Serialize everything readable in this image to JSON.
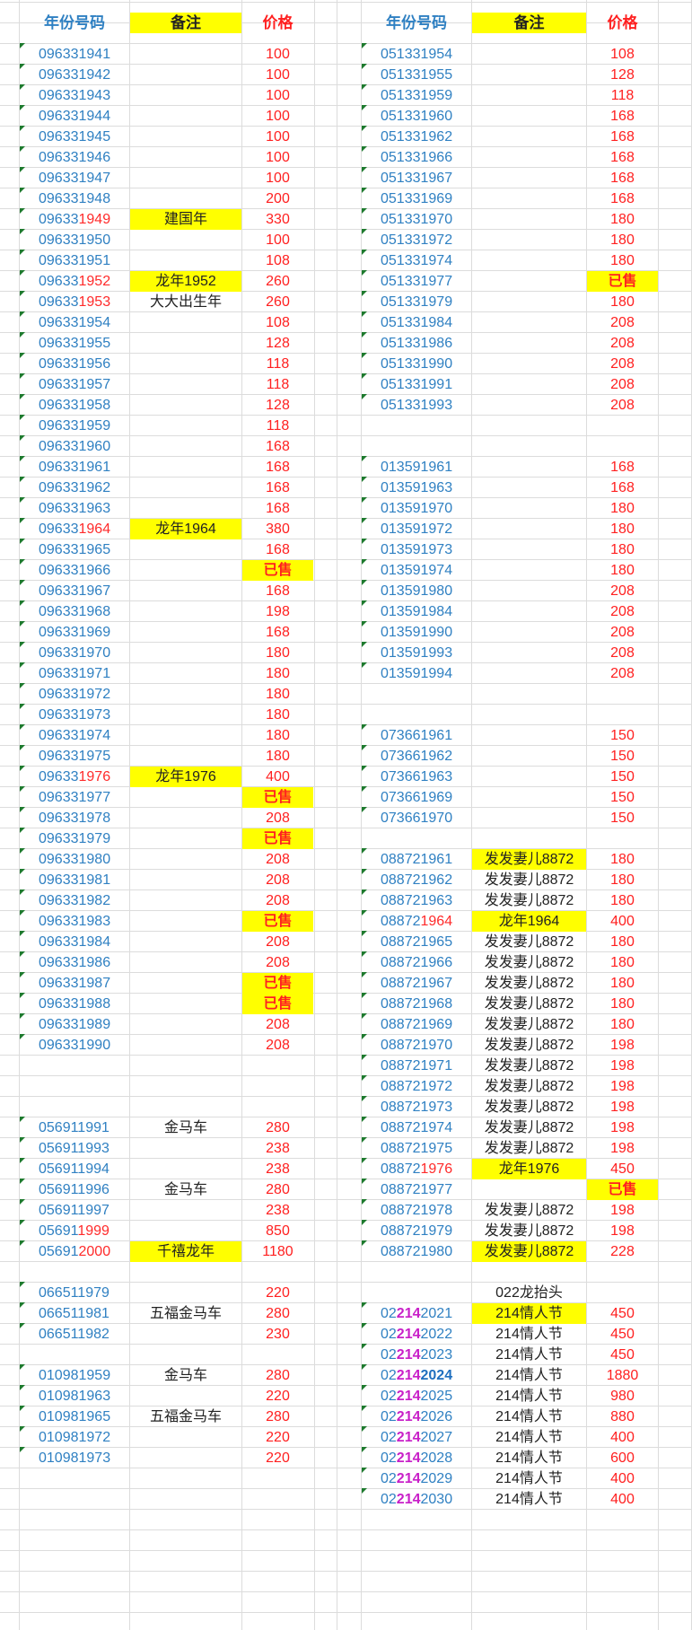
{
  "headers": {
    "left": {
      "number": "年份号码",
      "note": "备注",
      "price": "价格"
    },
    "right": {
      "number": "年份号码",
      "note": "备注",
      "price": "价格"
    }
  },
  "colors": {
    "number_blue": "#2f80c2",
    "red": "#ff2a2a",
    "yellow": "#ffff00",
    "purple": "#c81fc8",
    "green_marker": "#1e7a2e"
  },
  "left_rows": [
    {
      "row": 3,
      "parts": [
        "096331941"
      ],
      "note": "",
      "price": "100"
    },
    {
      "row": 4,
      "parts": [
        "096331942"
      ],
      "note": "",
      "price": "100"
    },
    {
      "row": 5,
      "parts": [
        "096331943"
      ],
      "note": "",
      "price": "100"
    },
    {
      "row": 6,
      "parts": [
        "096331944"
      ],
      "note": "",
      "price": "100"
    },
    {
      "row": 7,
      "parts": [
        "096331945"
      ],
      "note": "",
      "price": "100"
    },
    {
      "row": 8,
      "parts": [
        "096331946"
      ],
      "note": "",
      "price": "100"
    },
    {
      "row": 9,
      "parts": [
        "096331947"
      ],
      "note": "",
      "price": "100"
    },
    {
      "row": 10,
      "parts": [
        "096331948"
      ],
      "note": "",
      "price": "200"
    },
    {
      "row": 11,
      "parts": [
        "09633",
        "1949"
      ],
      "note": "建国年",
      "note_hl": true,
      "price": "330"
    },
    {
      "row": 12,
      "parts": [
        "096331950"
      ],
      "note": "",
      "price": "100"
    },
    {
      "row": 13,
      "parts": [
        "096331951"
      ],
      "note": "",
      "price": "108"
    },
    {
      "row": 14,
      "parts": [
        "09633",
        "1952"
      ],
      "note": "龙年1952",
      "note_hl": true,
      "price": "260"
    },
    {
      "row": 15,
      "parts": [
        "09633",
        "1953"
      ],
      "note": "大大出生年",
      "price": "260"
    },
    {
      "row": 16,
      "parts": [
        "096331954"
      ],
      "note": "",
      "price": "108"
    },
    {
      "row": 17,
      "parts": [
        "096331955"
      ],
      "note": "",
      "price": "128"
    },
    {
      "row": 18,
      "parts": [
        "096331956"
      ],
      "note": "",
      "price": "118"
    },
    {
      "row": 19,
      "parts": [
        "096331957"
      ],
      "note": "",
      "price": "118"
    },
    {
      "row": 20,
      "parts": [
        "096331958"
      ],
      "note": "",
      "price": "128"
    },
    {
      "row": 21,
      "parts": [
        "096331959"
      ],
      "note": "",
      "price": "118"
    },
    {
      "row": 22,
      "parts": [
        "096331960"
      ],
      "note": "",
      "price": "168"
    },
    {
      "row": 23,
      "parts": [
        "096331961"
      ],
      "note": "",
      "price": "168"
    },
    {
      "row": 24,
      "parts": [
        "096331962"
      ],
      "note": "",
      "price": "168"
    },
    {
      "row": 25,
      "parts": [
        "096331963"
      ],
      "note": "",
      "price": "168"
    },
    {
      "row": 26,
      "parts": [
        "09633",
        "1964"
      ],
      "note": "龙年1964",
      "note_hl": true,
      "price": "380"
    },
    {
      "row": 27,
      "parts": [
        "096331965"
      ],
      "note": "",
      "price": "168"
    },
    {
      "row": 28,
      "parts": [
        "096331966"
      ],
      "note": "",
      "price": "已售",
      "sold": true
    },
    {
      "row": 29,
      "parts": [
        "096331967"
      ],
      "note": "",
      "price": "168"
    },
    {
      "row": 30,
      "parts": [
        "096331968"
      ],
      "note": "",
      "price": "198"
    },
    {
      "row": 31,
      "parts": [
        "096331969"
      ],
      "note": "",
      "price": "168"
    },
    {
      "row": 32,
      "parts": [
        "096331970"
      ],
      "note": "",
      "price": "180"
    },
    {
      "row": 33,
      "parts": [
        "096331971"
      ],
      "note": "",
      "price": "180"
    },
    {
      "row": 34,
      "parts": [
        "096331972"
      ],
      "note": "",
      "price": "180"
    },
    {
      "row": 35,
      "parts": [
        "096331973"
      ],
      "note": "",
      "price": "180"
    },
    {
      "row": 36,
      "parts": [
        "096331974"
      ],
      "note": "",
      "price": "180"
    },
    {
      "row": 37,
      "parts": [
        "096331975"
      ],
      "note": "",
      "price": "180"
    },
    {
      "row": 38,
      "parts": [
        "09633",
        "1976"
      ],
      "note": "龙年1976",
      "note_hl": true,
      "price": "400"
    },
    {
      "row": 39,
      "parts": [
        "096331977"
      ],
      "note": "",
      "price": "已售",
      "sold": true
    },
    {
      "row": 40,
      "parts": [
        "096331978"
      ],
      "note": "",
      "price": "208"
    },
    {
      "row": 41,
      "parts": [
        "096331979"
      ],
      "note": "",
      "price": "已售",
      "sold": true
    },
    {
      "row": 42,
      "parts": [
        "096331980"
      ],
      "note": "",
      "price": "208"
    },
    {
      "row": 43,
      "parts": [
        "096331981"
      ],
      "note": "",
      "price": "208"
    },
    {
      "row": 44,
      "parts": [
        "096331982"
      ],
      "note": "",
      "price": "208"
    },
    {
      "row": 45,
      "parts": [
        "096331983"
      ],
      "note": "",
      "price": "已售",
      "sold": true
    },
    {
      "row": 46,
      "parts": [
        "096331984"
      ],
      "note": "",
      "price": "208"
    },
    {
      "row": 47,
      "parts": [
        "096331986"
      ],
      "note": "",
      "price": "208"
    },
    {
      "row": 48,
      "parts": [
        "096331987"
      ],
      "note": "",
      "price": "已售",
      "sold": true
    },
    {
      "row": 49,
      "parts": [
        "096331988"
      ],
      "note": "",
      "price": "已售",
      "sold": true
    },
    {
      "row": 50,
      "parts": [
        "096331989"
      ],
      "note": "",
      "price": "208"
    },
    {
      "row": 51,
      "parts": [
        "096331990"
      ],
      "note": "",
      "price": "208"
    },
    {
      "row": 55,
      "parts": [
        "056911991"
      ],
      "note": "金马车",
      "price": "280"
    },
    {
      "row": 56,
      "parts": [
        "056911993"
      ],
      "note": "",
      "price": "238"
    },
    {
      "row": 57,
      "parts": [
        "056911994"
      ],
      "note": "",
      "price": "238"
    },
    {
      "row": 58,
      "parts": [
        "056911996"
      ],
      "note": "金马车",
      "price": "280"
    },
    {
      "row": 59,
      "parts": [
        "056911997"
      ],
      "note": "",
      "price": "238"
    },
    {
      "row": 60,
      "parts": [
        "05691",
        "1999"
      ],
      "note": "",
      "price": "850"
    },
    {
      "row": 61,
      "parts": [
        "05691",
        "2000"
      ],
      "note": "千禧龙年",
      "note_hl": true,
      "price": "1180"
    },
    {
      "row": 63,
      "parts": [
        "066511979"
      ],
      "note": "",
      "price": "220"
    },
    {
      "row": 64,
      "parts": [
        "066511981"
      ],
      "note": "五福金马车",
      "price": "280"
    },
    {
      "row": 65,
      "parts": [
        "066511982"
      ],
      "note": "",
      "price": "230"
    },
    {
      "row": 67,
      "parts": [
        "010981959"
      ],
      "note": "金马车",
      "price": "280"
    },
    {
      "row": 68,
      "parts": [
        "010981963"
      ],
      "note": "",
      "price": "220"
    },
    {
      "row": 69,
      "parts": [
        "010981965"
      ],
      "note": "五福金马车",
      "price": "280"
    },
    {
      "row": 70,
      "parts": [
        "010981972"
      ],
      "note": "",
      "price": "220"
    },
    {
      "row": 71,
      "parts": [
        "010981973"
      ],
      "note": "",
      "price": "220"
    }
  ],
  "right_rows": [
    {
      "row": 3,
      "parts": [
        "051331954"
      ],
      "note": "",
      "price": "108"
    },
    {
      "row": 4,
      "parts": [
        "051331955"
      ],
      "note": "",
      "price": "128"
    },
    {
      "row": 5,
      "parts": [
        "051331959"
      ],
      "note": "",
      "price": "118"
    },
    {
      "row": 6,
      "parts": [
        "051331960"
      ],
      "note": "",
      "price": "168"
    },
    {
      "row": 7,
      "parts": [
        "051331962"
      ],
      "note": "",
      "price": "168"
    },
    {
      "row": 8,
      "parts": [
        "051331966"
      ],
      "note": "",
      "price": "168"
    },
    {
      "row": 9,
      "parts": [
        "051331967"
      ],
      "note": "",
      "price": "168"
    },
    {
      "row": 10,
      "parts": [
        "051331969"
      ],
      "note": "",
      "price": "168"
    },
    {
      "row": 11,
      "parts": [
        "051331970"
      ],
      "note": "",
      "price": "180"
    },
    {
      "row": 12,
      "parts": [
        "051331972"
      ],
      "note": "",
      "price": "180"
    },
    {
      "row": 13,
      "parts": [
        "051331974"
      ],
      "note": "",
      "price": "180"
    },
    {
      "row": 14,
      "parts": [
        "051331977"
      ],
      "note": "",
      "price": "已售",
      "sold": true
    },
    {
      "row": 15,
      "parts": [
        "051331979"
      ],
      "note": "",
      "price": "180"
    },
    {
      "row": 16,
      "parts": [
        "051331984"
      ],
      "note": "",
      "price": "208"
    },
    {
      "row": 17,
      "parts": [
        "051331986"
      ],
      "note": "",
      "price": "208"
    },
    {
      "row": 18,
      "parts": [
        "051331990"
      ],
      "note": "",
      "price": "208"
    },
    {
      "row": 19,
      "parts": [
        "051331991"
      ],
      "note": "",
      "price": "208"
    },
    {
      "row": 20,
      "parts": [
        "051331993"
      ],
      "note": "",
      "price": "208"
    },
    {
      "row": 23,
      "parts": [
        "013591961"
      ],
      "note": "",
      "price": "168"
    },
    {
      "row": 24,
      "parts": [
        "013591963"
      ],
      "note": "",
      "price": "168"
    },
    {
      "row": 25,
      "parts": [
        "013591970"
      ],
      "note": "",
      "price": "180"
    },
    {
      "row": 26,
      "parts": [
        "013591972"
      ],
      "note": "",
      "price": "180"
    },
    {
      "row": 27,
      "parts": [
        "013591973"
      ],
      "note": "",
      "price": "180"
    },
    {
      "row": 28,
      "parts": [
        "013591974"
      ],
      "note": "",
      "price": "180"
    },
    {
      "row": 29,
      "parts": [
        "013591980"
      ],
      "note": "",
      "price": "208"
    },
    {
      "row": 30,
      "parts": [
        "013591984"
      ],
      "note": "",
      "price": "208"
    },
    {
      "row": 31,
      "parts": [
        "013591990"
      ],
      "note": "",
      "price": "208"
    },
    {
      "row": 32,
      "parts": [
        "013591993"
      ],
      "note": "",
      "price": "208"
    },
    {
      "row": 33,
      "parts": [
        "013591994"
      ],
      "note": "",
      "price": "208"
    },
    {
      "row": 36,
      "parts": [
        "073661961"
      ],
      "note": "",
      "price": "150"
    },
    {
      "row": 37,
      "parts": [
        "073661962"
      ],
      "note": "",
      "price": "150"
    },
    {
      "row": 38,
      "parts": [
        "073661963"
      ],
      "note": "",
      "price": "150"
    },
    {
      "row": 39,
      "parts": [
        "073661969"
      ],
      "note": "",
      "price": "150"
    },
    {
      "row": 40,
      "parts": [
        "073661970"
      ],
      "note": "",
      "price": "150"
    },
    {
      "row": 42,
      "parts": [
        "088721961"
      ],
      "note": "发发妻儿8872",
      "note_hl": true,
      "price": "180"
    },
    {
      "row": 43,
      "parts": [
        "088721962"
      ],
      "note": "发发妻儿8872",
      "price": "180"
    },
    {
      "row": 44,
      "parts": [
        "088721963"
      ],
      "note": "发发妻儿8872",
      "price": "180"
    },
    {
      "row": 45,
      "parts": [
        "08872",
        "1964"
      ],
      "note": "龙年1964",
      "note_hl": true,
      "price": "400"
    },
    {
      "row": 46,
      "parts": [
        "088721965"
      ],
      "note": "发发妻儿8872",
      "price": "180"
    },
    {
      "row": 47,
      "parts": [
        "088721966"
      ],
      "note": "发发妻儿8872",
      "price": "180"
    },
    {
      "row": 48,
      "parts": [
        "088721967"
      ],
      "note": "发发妻儿8872",
      "price": "180"
    },
    {
      "row": 49,
      "parts": [
        "088721968"
      ],
      "note": "发发妻儿8872",
      "price": "180"
    },
    {
      "row": 50,
      "parts": [
        "088721969"
      ],
      "note": "发发妻儿8872",
      "price": "180"
    },
    {
      "row": 51,
      "parts": [
        "088721970"
      ],
      "note": "发发妻儿8872",
      "price": "198"
    },
    {
      "row": 52,
      "parts": [
        "088721971"
      ],
      "note": "发发妻儿8872",
      "price": "198"
    },
    {
      "row": 53,
      "parts": [
        "088721972"
      ],
      "note": "发发妻儿8872",
      "price": "198"
    },
    {
      "row": 54,
      "parts": [
        "088721973"
      ],
      "note": "发发妻儿8872",
      "price": "198"
    },
    {
      "row": 55,
      "parts": [
        "088721974"
      ],
      "note": "发发妻儿8872",
      "price": "198"
    },
    {
      "row": 56,
      "parts": [
        "088721975"
      ],
      "note": "发发妻儿8872",
      "price": "198"
    },
    {
      "row": 57,
      "parts": [
        "08872",
        "1976"
      ],
      "note": "龙年1976",
      "note_hl": true,
      "price": "450"
    },
    {
      "row": 58,
      "parts": [
        "088721977"
      ],
      "note": "",
      "price": "已售",
      "sold": true
    },
    {
      "row": 59,
      "parts": [
        "088721978"
      ],
      "note": "发发妻儿8872",
      "price": "198"
    },
    {
      "row": 60,
      "parts": [
        "088721979"
      ],
      "note": "发发妻儿8872",
      "price": "198"
    },
    {
      "row": 61,
      "parts": [
        "088721980"
      ],
      "note": "发发妻儿8872",
      "note_hl": true,
      "price": "228"
    },
    {
      "row": 63,
      "parts": [],
      "note": "022龙抬头",
      "price": ""
    },
    {
      "row": 64,
      "parts": [
        "02",
        "214",
        "2021"
      ],
      "style": "purple",
      "note": "214情人节",
      "note_hl": true,
      "price": "450"
    },
    {
      "row": 65,
      "parts": [
        "02",
        "214",
        "2022"
      ],
      "style": "purple",
      "note": "214情人节",
      "price": "450"
    },
    {
      "row": 66,
      "parts": [
        "02",
        "214",
        "2023"
      ],
      "style": "purple",
      "note": "214情人节",
      "price": "450"
    },
    {
      "row": 67,
      "parts": [
        "02",
        "214",
        "2024"
      ],
      "style": "purple-bold",
      "note": "214情人节",
      "price": "1880"
    },
    {
      "row": 68,
      "parts": [
        "02",
        "214",
        "2025"
      ],
      "style": "purple",
      "note": "214情人节",
      "price": "980"
    },
    {
      "row": 69,
      "parts": [
        "02",
        "214",
        "2026"
      ],
      "style": "purple",
      "note": "214情人节",
      "price": "880"
    },
    {
      "row": 70,
      "parts": [
        "02",
        "214",
        "2027"
      ],
      "style": "purple",
      "note": "214情人节",
      "price": "400"
    },
    {
      "row": 71,
      "parts": [
        "02",
        "214",
        "2028"
      ],
      "style": "purple",
      "note": "214情人节",
      "price": "600"
    },
    {
      "row": 72,
      "parts": [
        "02",
        "214",
        "2029"
      ],
      "style": "purple",
      "note": "214情人节",
      "price": "400"
    },
    {
      "row": 73,
      "parts": [
        "02",
        "214",
        "2030"
      ],
      "style": "purple",
      "note": "214情人节",
      "price": "400"
    }
  ]
}
